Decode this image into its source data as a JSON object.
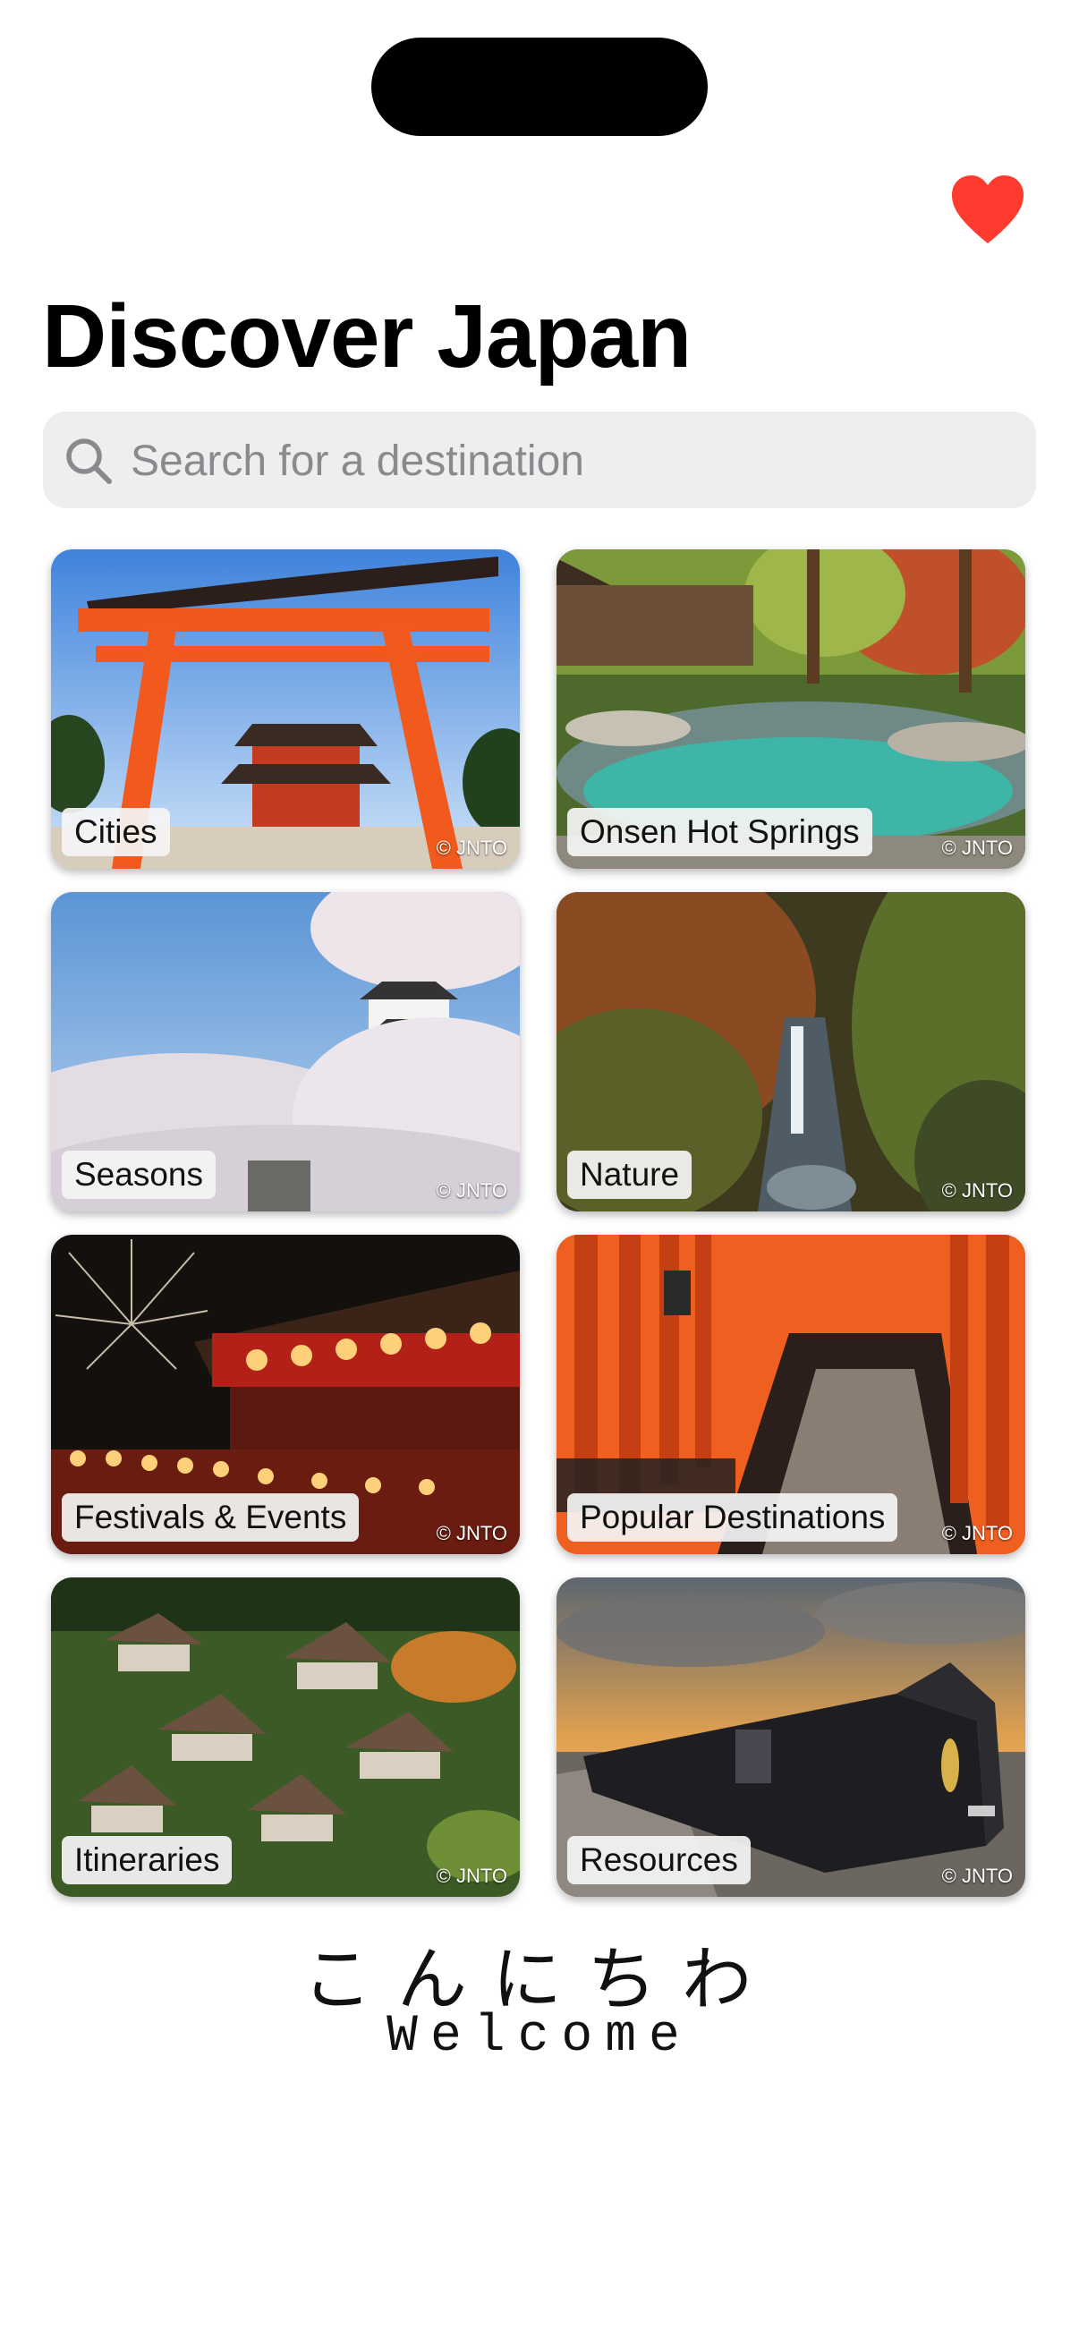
{
  "page_title": "Discover Japan",
  "search": {
    "placeholder": "Search for a destination"
  },
  "icons": {
    "favorite": "heart-icon",
    "search": "magnifying-glass-icon"
  },
  "colors": {
    "heart": "#ff3b30",
    "search_bg": "#eeeeef",
    "placeholder": "#8a8a8e"
  },
  "categories": [
    {
      "label": "Cities",
      "credit": "© JNTO"
    },
    {
      "label": "Onsen Hot Springs",
      "credit": "© JNTO"
    },
    {
      "label": "Seasons",
      "credit": "© JNTO"
    },
    {
      "label": "Nature",
      "credit": "© JNTO"
    },
    {
      "label": "Festivals & Events",
      "credit": "© JNTO"
    },
    {
      "label": "Popular Destinations",
      "credit": "© JNTO"
    },
    {
      "label": "Itineraries",
      "credit": "© JNTO"
    },
    {
      "label": "Resources",
      "credit": "© JNTO"
    }
  ],
  "footer": {
    "greeting_jp": "こんにちわ",
    "greeting_en": "Welcome"
  }
}
